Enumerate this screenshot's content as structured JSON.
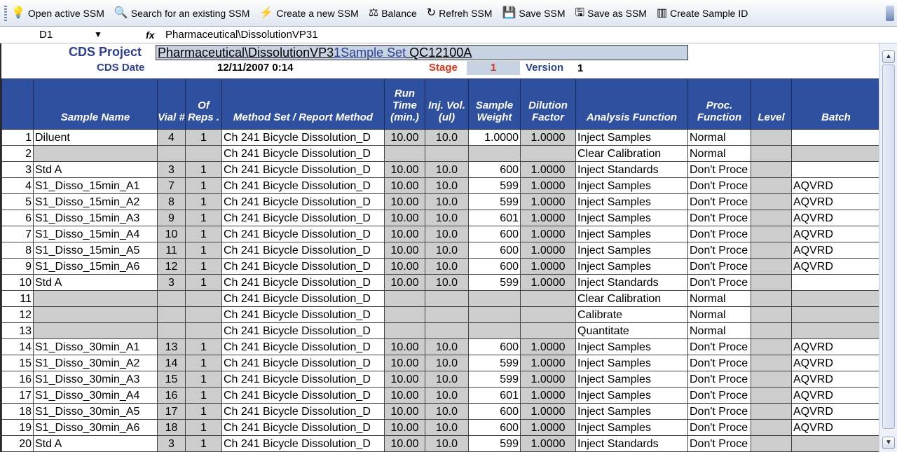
{
  "toolbar": {
    "items": [
      {
        "label": "Open active SSM",
        "icon": "bulb-icon",
        "glyph": "💡"
      },
      {
        "label": "Search for an existing SSM",
        "icon": "search-icon",
        "glyph": "🔍"
      },
      {
        "label": "Create a new SSM",
        "icon": "lightning-icon",
        "glyph": "⚡"
      },
      {
        "label": "Balance",
        "icon": "balance-icon",
        "glyph": "⚖"
      },
      {
        "label": "Refreh SSM",
        "icon": "refresh-icon",
        "glyph": "↻"
      },
      {
        "label": "Save SSM",
        "icon": "save-icon",
        "glyph": "💾"
      },
      {
        "label": "Save as SSM",
        "icon": "save-as-icon",
        "glyph": "🖫"
      },
      {
        "label": "Create Sample ID",
        "icon": "barcode-icon",
        "glyph": "▥"
      }
    ]
  },
  "formula_bar": {
    "cell": "D1",
    "fx": "fx",
    "value": "Pharmaceutical\\DissolutionVP31"
  },
  "header": {
    "project_label": "CDS Project",
    "project_part1": "Pharmaceutical\\DissolutionVP3",
    "project_part2": "1Sample Set",
    "project_part3": "  QC12100A",
    "date_label": "CDS Date",
    "date_value": "12/11/2007 0:14",
    "stage_label": "Stage",
    "stage_value": "1",
    "version_label": "Version",
    "version_value": "1"
  },
  "columns": [
    "",
    "Sample Name",
    "Vial #",
    "Of Reps .",
    "Method Set / Report Method",
    "Run Time (min.)",
    "Inj. Vol. (ul)",
    "Sample Weight",
    "Dilution Factor",
    "Analysis Function",
    "Proc. Function",
    "Level",
    "Batch"
  ],
  "rows": [
    {
      "n": "1",
      "name": "Diluent",
      "vial": "4",
      "reps": "1",
      "method": "Ch 241 Bicycle Dissolution_D",
      "run": "10.00",
      "inj": "10.0",
      "weight": "1.0000",
      "dil": "1.0000",
      "func": "Inject Samples",
      "proc": "Normal",
      "level": "",
      "batch": ""
    },
    {
      "n": "2",
      "name": "",
      "vial": "",
      "reps": "",
      "method": "Ch 241 Bicycle Dissolution_D",
      "run": "",
      "inj": "",
      "weight": "",
      "dil": "",
      "func": "Clear Calibration",
      "proc": "Normal",
      "level": "",
      "batch": ""
    },
    {
      "n": "3",
      "name": "Std A",
      "vial": "3",
      "reps": "1",
      "method": "Ch 241 Bicycle Dissolution_D",
      "run": "10.00",
      "inj": "10.0",
      "weight": "600",
      "dil": "1.0000",
      "func": "Inject Standards",
      "proc": "Don't Proce",
      "level": "",
      "batch": ""
    },
    {
      "n": "4",
      "name": "S1_Disso_15min_A1",
      "vial": "7",
      "reps": "1",
      "method": "Ch 241 Bicycle Dissolution_D",
      "run": "10.00",
      "inj": "10.0",
      "weight": "599",
      "dil": "1.0000",
      "func": "Inject Samples",
      "proc": "Don't Proce",
      "level": "",
      "batch": "AQVRD"
    },
    {
      "n": "5",
      "name": "S1_Disso_15min_A2",
      "vial": "8",
      "reps": "1",
      "method": "Ch 241 Bicycle Dissolution_D",
      "run": "10.00",
      "inj": "10.0",
      "weight": "599",
      "dil": "1.0000",
      "func": "Inject Samples",
      "proc": "Don't Proce",
      "level": "",
      "batch": "AQVRD"
    },
    {
      "n": "6",
      "name": "S1_Disso_15min_A3",
      "vial": "9",
      "reps": "1",
      "method": "Ch 241 Bicycle Dissolution_D",
      "run": "10.00",
      "inj": "10.0",
      "weight": "601",
      "dil": "1.0000",
      "func": "Inject Samples",
      "proc": "Don't Proce",
      "level": "",
      "batch": "AQVRD"
    },
    {
      "n": "7",
      "name": "S1_Disso_15min_A4",
      "vial": "10",
      "reps": "1",
      "method": "Ch 241 Bicycle Dissolution_D",
      "run": "10.00",
      "inj": "10.0",
      "weight": "600",
      "dil": "1.0000",
      "func": "Inject Samples",
      "proc": "Don't Proce",
      "level": "",
      "batch": "AQVRD"
    },
    {
      "n": "8",
      "name": "S1_Disso_15min_A5",
      "vial": "11",
      "reps": "1",
      "method": "Ch 241 Bicycle Dissolution_D",
      "run": "10.00",
      "inj": "10.0",
      "weight": "600",
      "dil": "1.0000",
      "func": "Inject Samples",
      "proc": "Don't Proce",
      "level": "",
      "batch": "AQVRD"
    },
    {
      "n": "9",
      "name": "S1_Disso_15min_A6",
      "vial": "12",
      "reps": "1",
      "method": "Ch 241 Bicycle Dissolution_D",
      "run": "10.00",
      "inj": "10.0",
      "weight": "600",
      "dil": "1.0000",
      "func": "Inject Samples",
      "proc": "Don't Proce",
      "level": "",
      "batch": "AQVRD"
    },
    {
      "n": "10",
      "name": "Std A",
      "vial": "3",
      "reps": "1",
      "method": "Ch 241 Bicycle Dissolution_D",
      "run": "10.00",
      "inj": "10.0",
      "weight": "599",
      "dil": "1.0000",
      "func": "Inject Standards",
      "proc": "Don't Proce",
      "level": "",
      "batch": ""
    },
    {
      "n": "11",
      "name": "",
      "vial": "",
      "reps": "",
      "method": "Ch 241 Bicycle Dissolution_D",
      "run": "",
      "inj": "",
      "weight": "",
      "dil": "",
      "func": "Clear Calibration",
      "proc": "Normal",
      "level": "",
      "batch": ""
    },
    {
      "n": "12",
      "name": "",
      "vial": "",
      "reps": "",
      "method": "Ch 241 Bicycle Dissolution_D",
      "run": "",
      "inj": "",
      "weight": "",
      "dil": "",
      "func": "Calibrate",
      "proc": "Normal",
      "level": "",
      "batch": ""
    },
    {
      "n": "13",
      "name": "",
      "vial": "",
      "reps": "",
      "method": "Ch 241 Bicycle Dissolution_D",
      "run": "",
      "inj": "",
      "weight": "",
      "dil": "",
      "func": "Quantitate",
      "proc": "Normal",
      "level": "",
      "batch": ""
    },
    {
      "n": "14",
      "name": "S1_Disso_30min_A1",
      "vial": "13",
      "reps": "1",
      "method": "Ch 241 Bicycle Dissolution_D",
      "run": "10.00",
      "inj": "10.0",
      "weight": "600",
      "dil": "1.0000",
      "func": "Inject Samples",
      "proc": "Don't Proce",
      "level": "",
      "batch": "AQVRD"
    },
    {
      "n": "15",
      "name": "S1_Disso_30min_A2",
      "vial": "14",
      "reps": "1",
      "method": "Ch 241 Bicycle Dissolution_D",
      "run": "10.00",
      "inj": "10.0",
      "weight": "599",
      "dil": "1.0000",
      "func": "Inject Samples",
      "proc": "Don't Proce",
      "level": "",
      "batch": "AQVRD"
    },
    {
      "n": "16",
      "name": "S1_Disso_30min_A3",
      "vial": "15",
      "reps": "1",
      "method": "Ch 241 Bicycle Dissolution_D",
      "run": "10.00",
      "inj": "10.0",
      "weight": "599",
      "dil": "1.0000",
      "func": "Inject Samples",
      "proc": "Don't Proce",
      "level": "",
      "batch": "AQVRD"
    },
    {
      "n": "17",
      "name": "S1_Disso_30min_A4",
      "vial": "16",
      "reps": "1",
      "method": "Ch 241 Bicycle Dissolution_D",
      "run": "10.00",
      "inj": "10.0",
      "weight": "601",
      "dil": "1.0000",
      "func": "Inject Samples",
      "proc": "Don't Proce",
      "level": "",
      "batch": "AQVRD"
    },
    {
      "n": "18",
      "name": "S1_Disso_30min_A5",
      "vial": "17",
      "reps": "1",
      "method": "Ch 241 Bicycle Dissolution_D",
      "run": "10.00",
      "inj": "10.0",
      "weight": "600",
      "dil": "1.0000",
      "func": "Inject Samples",
      "proc": "Don't Proce",
      "level": "",
      "batch": "AQVRD"
    },
    {
      "n": "19",
      "name": "S1_Disso_30min_A6",
      "vial": "18",
      "reps": "1",
      "method": "Ch 241 Bicycle Dissolution_D",
      "run": "10.00",
      "inj": "10.0",
      "weight": "600",
      "dil": "1.0000",
      "func": "Inject Samples",
      "proc": "Don't Proce",
      "level": "",
      "batch": "AQVRD"
    },
    {
      "n": "20",
      "name": "Std A",
      "vial": "3",
      "reps": "1",
      "method": "Ch 241 Bicycle Dissolution_D",
      "run": "10.00",
      "inj": "10.0",
      "weight": "599",
      "dil": "1.0000",
      "func": "Inject Standards",
      "proc": "Don't Proce",
      "level": "",
      "batch": ""
    }
  ],
  "colors": {
    "header_bg": "#2f4f9f",
    "grey_cell": "#cdcdcd",
    "label_blue": "#2e3f8f",
    "stage_red": "#d8341c",
    "field_bg": "#c7d2e2"
  }
}
